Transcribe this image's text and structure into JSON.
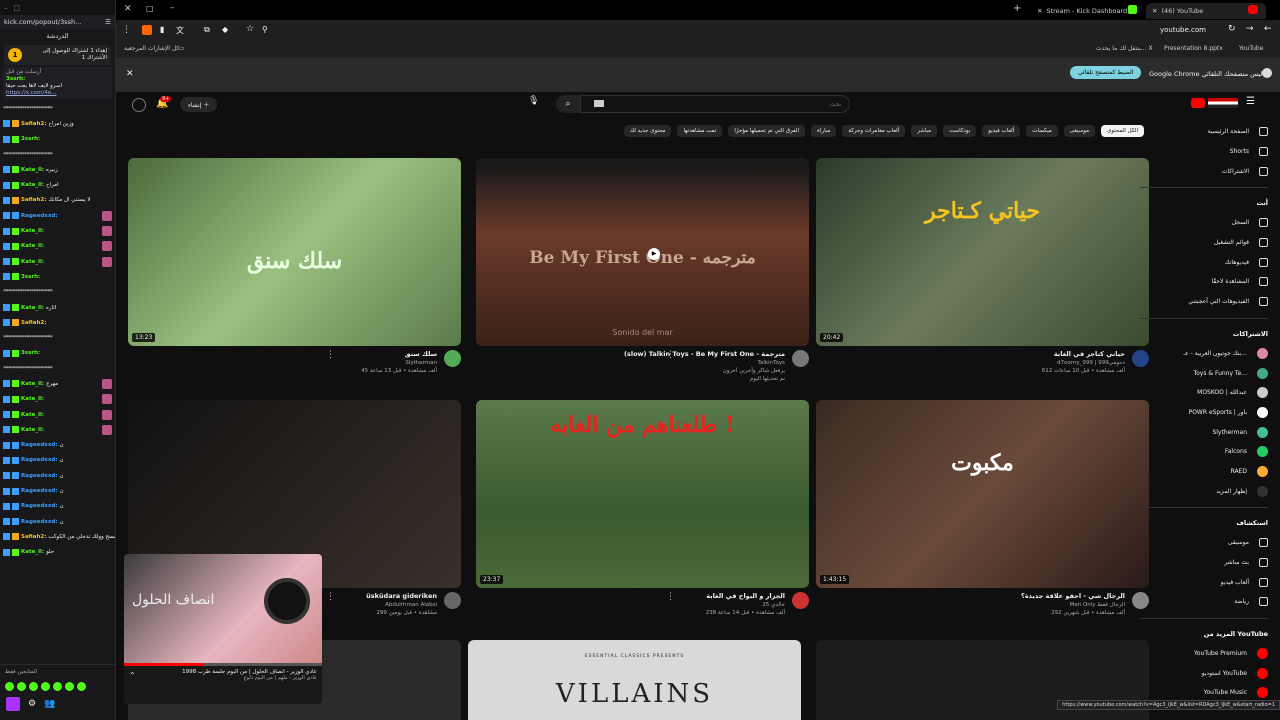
{
  "chat": {
    "window_url": "kick.com/popout/3ssh...",
    "header": "الدردشة",
    "goal_badge": "1",
    "goal_text": "إهداء 1 اشتراك للوصول إلى الأشتراك 1",
    "pinned_user": "أرسلت من قبل",
    "pinned_name": "3ssrh:",
    "pinned_text": "اسرو لايف لاها يعت حيقا",
    "pinned_link": "https://x.com/4e...",
    "messages": [
      {
        "type": "dash"
      },
      {
        "name": "Safiah2:",
        "color": "#f5c518",
        "text": "وزين امراح",
        "icon": "i3"
      },
      {
        "name": "3ssrh:",
        "color": "#53fc18",
        "text": "",
        "icon": "i2"
      },
      {
        "type": "dash"
      },
      {
        "name": "Kata_ll:",
        "color": "#53fc18",
        "text": "زبيره",
        "icon": "i2"
      },
      {
        "name": "Kata_ll:",
        "color": "#53fc18",
        "text": "امراح",
        "icon": "i2"
      },
      {
        "name": "Safiah2:",
        "color": "#f5c518",
        "text": "لا يستني ال مكانك",
        "icon": "i3"
      },
      {
        "name": "Rageedxxd:",
        "color": "#3aa0ff",
        "text": "",
        "icon": "i1",
        "avatar": true
      },
      {
        "name": "Kate_ll:",
        "color": "#53fc18",
        "text": "",
        "icon": "i2",
        "avatar": true
      },
      {
        "name": "Kate_ll:",
        "color": "#53fc18",
        "text": "",
        "icon": "i2",
        "avatar": true
      },
      {
        "name": "Kate_ll:",
        "color": "#53fc18",
        "text": "",
        "icon": "i2",
        "avatar": true
      },
      {
        "name": "3ssrh:",
        "color": "#53fc18",
        "text": "",
        "icon": "i2"
      },
      {
        "type": "dash"
      },
      {
        "name": "Kata_ll:",
        "color": "#53fc18",
        "text": "اثاره",
        "icon": "i2"
      },
      {
        "name": "Safiah2:",
        "color": "#f5c518",
        "text": "",
        "icon": "i3"
      },
      {
        "type": "dash"
      },
      {
        "name": "3ssrh:",
        "color": "#53fc18",
        "text": "",
        "icon": "i2"
      },
      {
        "type": "dash"
      },
      {
        "name": "Kate_ll:",
        "color": "#53fc18",
        "text": "مهرج",
        "icon": "i2",
        "avatar": true
      },
      {
        "name": "Kate_ll:",
        "color": "#53fc18",
        "text": "",
        "icon": "i2",
        "avatar": true
      },
      {
        "name": "Kate_ll:",
        "color": "#53fc18",
        "text": "",
        "icon": "i2",
        "avatar": true
      },
      {
        "name": "Kate_ll:",
        "color": "#53fc18",
        "text": "",
        "icon": "i2",
        "avatar": true
      },
      {
        "name": "Rageedxxd:",
        "color": "#3aa0ff",
        "text": "ن",
        "icon": "i1"
      },
      {
        "name": "Rageedxxd:",
        "color": "#3aa0ff",
        "text": "ن",
        "icon": "i1"
      },
      {
        "name": "Rageedxxd:",
        "color": "#3aa0ff",
        "text": "ن",
        "icon": "i1"
      },
      {
        "name": "Rageedxxd:",
        "color": "#3aa0ff",
        "text": "ن",
        "icon": "i1"
      },
      {
        "name": "Rageedxxd:",
        "color": "#3aa0ff",
        "text": "ن",
        "icon": "i1"
      },
      {
        "name": "Rageedxxd:",
        "color": "#3aa0ff",
        "text": "ن",
        "icon": "i1"
      },
      {
        "name": "Safiah2:",
        "color": "#f5c518",
        "text": "ونح مسح وولك تدخلي من الكوكب",
        "icon": "i3"
      },
      {
        "name": "Kate_ll:",
        "color": "#53fc18",
        "text": "حلو",
        "icon": "i2"
      }
    ],
    "dash_text": "****************************",
    "footer_label": "المتابعين فقط"
  },
  "browser": {
    "tabs": [
      {
        "label": "Stream - Kick Dashboard"
      },
      {
        "label": "(46) YouTube"
      }
    ],
    "address": "youtube.com",
    "bookmarks": {
      "left": "كل الإشارات المرجعية",
      "b1": "Presentation 8.pptx",
      "b2": "YouTube",
      "b3": "ينتقل لك ما يحدث... X"
    },
    "infobar": {
      "text": "Google Chrome ليس متصفحك التلقائي",
      "button": "الضبط كمتصفح تلقائي"
    }
  },
  "youtube": {
    "search_placeholder": "بحث",
    "create_label": "إنشاء",
    "notif_count": "9+",
    "chips": [
      "الكل المحتوى",
      "موسيقى",
      "ميكسات",
      "ألعاب فيديو",
      "بودكاست",
      "مباشر",
      "ألعاب مغامرات وحركة",
      "مباراة",
      "الفرق التي تم تحميلها مؤخرًا",
      "تمت مشاهدتها",
      "محتوى جديد لك"
    ],
    "sidebar": {
      "main": [
        {
          "label": "الصفحة الرئيسية",
          "icon": "home-icon"
        },
        {
          "label": "Shorts",
          "icon": "shorts-icon"
        },
        {
          "label": "الاشتراكات",
          "icon": "subscriptions-icon"
        }
      ],
      "you_header": "أنت",
      "you": [
        {
          "label": "السجل",
          "icon": "history-icon"
        },
        {
          "label": "قوائم التشغيل",
          "icon": "playlist-icon"
        },
        {
          "label": "فيديوهاتك",
          "icon": "video-icon"
        },
        {
          "label": "المشاهدة لاحقًا",
          "icon": "clock-icon"
        },
        {
          "label": "الفيديوهات التي أعجبتني",
          "icon": "like-icon"
        }
      ],
      "subs_header": "الاشتراكات",
      "subs": [
        {
          "label": "بنك جوتيون العربية - عـ...",
          "color": "#d8a"
        },
        {
          "label": "Toys & Funny Te...",
          "color": "#4a8"
        },
        {
          "label": "MOSKOO | عبدالله",
          "color": "#ccc"
        },
        {
          "label": "POWR eSports | باور",
          "color": "#fff"
        },
        {
          "label": "Slytherman",
          "color": "#4b9"
        },
        {
          "label": "Falcons",
          "color": "#2c6"
        },
        {
          "label": "RAED",
          "color": "#fa3"
        },
        {
          "label": "إظهار المزيد",
          "color": "#333"
        }
      ],
      "explore_header": "استكشاف",
      "explore": [
        {
          "label": "موسيقى",
          "icon": "music-icon"
        },
        {
          "label": "بث مباشر",
          "icon": "live-icon"
        },
        {
          "label": "ألعاب فيديو",
          "icon": "game-icon"
        },
        {
          "label": "رياضة",
          "icon": "trophy-icon"
        }
      ],
      "more_header": "المزيد من YouTube",
      "more": [
        {
          "label": "YouTube Premium"
        },
        {
          "label": "استوديو YouTube"
        },
        {
          "label": "YouTube Music"
        }
      ]
    },
    "videos": [
      {
        "title": "سلك سنق",
        "channel": "Slytherman",
        "stats": "45 ألف مشاهدة • قبل 13 ساعة",
        "duration": "13:23",
        "thumb_text": "سلك سنق"
      },
      {
        "title": "(slow) Talkin Toys - Be My First One - مترجمة",
        "channel": "TalkinToys",
        "stats": "يرفعل شاكر وآخرين آخرون",
        "stats2": "تم تحديثها اليوم",
        "duration": "",
        "thumb_text": "Be My First One - مترجمه",
        "thumb_sub": "Sonido del mar"
      },
      {
        "title": "حياتي كتاجر في الغابة",
        "channel": "d7oorny_999 | دحومي999",
        "stats": "612 ألف مشاهدة • قبل 10 ساعات",
        "duration": "20:42",
        "thumb_text": "حياتي كـتاجر"
      },
      {
        "title": "üsküdara gideriken",
        "channel": "Abdulrhman Alabsi",
        "stats": "299 مشاهدة • قبل يومين",
        "duration": "",
        "thumb_text": ""
      },
      {
        "title": "الجزار و البواح في الغابة",
        "channel": "خالدي 25",
        "stats": "238 ألف مشاهدة • قبل 14 ساعة",
        "duration": "23:37",
        "thumb_text": "طلعناهم من الغابه !"
      },
      {
        "title": "الرجال شي - احقو علاقة جديدة؟",
        "channel": "Men Only الرجال فقط",
        "stats": "292 ألف مشاهدة • قبل شهرين",
        "duration": "1:43:15",
        "thumb_text": "مكبوت"
      }
    ],
    "row3_text": "VILLAINS",
    "row3_sub": "ESSENTIAL CLASSICS PRESENTS",
    "miniplayer": {
      "title": "عادي الوزير - انصاف الحلول | من ألبوم جلسة طرب 1998",
      "subtitle": "عادي الوزير - ملهم | من ألبوم دلوع",
      "art_text": "انصاف الحلول"
    },
    "status_url": "https://www.youtube.com/watch?v=Agc3_IJkE_w&list=RDAgc3_IJkE_w&start_radio=1"
  }
}
